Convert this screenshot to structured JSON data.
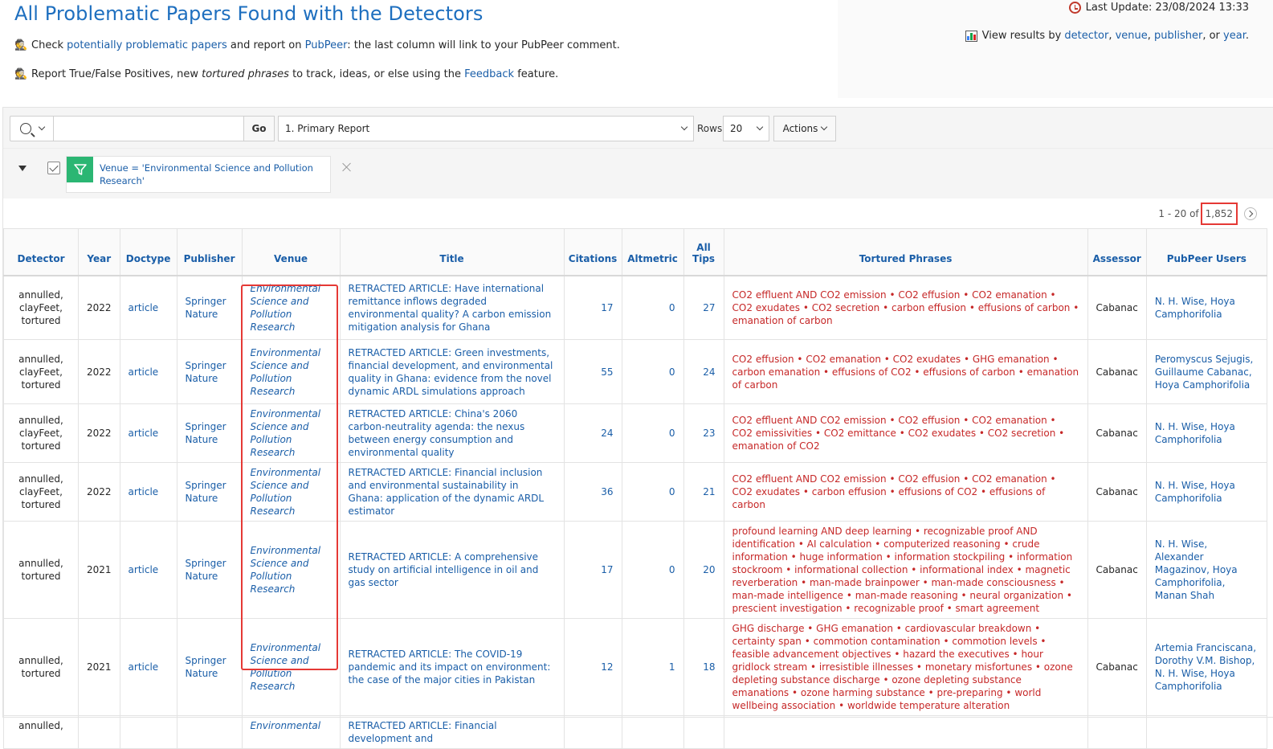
{
  "header": {
    "title": "All Problematic Papers Found with the Detectors",
    "line1": {
      "prefix": "Check ",
      "link1": "potentially problematic papers",
      "mid": " and report on ",
      "link2": "PubPeer",
      "suffix": ": the last column will link to your PubPeer comment."
    },
    "line2": {
      "prefix": "Report True/False Positives, new ",
      "italic": "tortured phrases",
      "mid": " to track, ideas, or else using the ",
      "link": "Feedback",
      "suffix": " feature."
    },
    "last_update": "Last Update: 23/08/2024 13:33",
    "view_results": {
      "prefix": "View results by ",
      "detector": "detector",
      "sep1": ", ",
      "venue": "venue",
      "sep2": ", ",
      "publisher": "publisher",
      "sep3": ", or ",
      "year": "year",
      "suffix": "."
    }
  },
  "toolbar": {
    "search_value": "",
    "go_label": "Go",
    "report_selected": "1. Primary Report",
    "rows_label": "Rows",
    "rows_value": "20",
    "actions_label": "Actions"
  },
  "filter": {
    "text": "Venue = 'Environmental Science and Pollution Research'"
  },
  "pagination": {
    "range": "1 - 20 of",
    "total": "1,852"
  },
  "table": {
    "columns": [
      "Detector",
      "Year",
      "Doctype",
      "Publisher",
      "Venue",
      "Title",
      "Citations",
      "Altmetric",
      "All Tips",
      "Tortured Phrases",
      "Assessor",
      "PubPeer Users"
    ],
    "rows": [
      {
        "detector": "annulled, clayFeet, tortured",
        "year": "2022",
        "doctype": "article",
        "publisher": "Springer Nature",
        "venue": "Environmental Science and Pollution Research",
        "title": "RETRACTED ARTICLE: Have international remittance inflows degraded environmental quality? A carbon emission mitigation analysis for Ghana",
        "citations": "17",
        "altmetric": "0",
        "tips": "27",
        "phrases": "CO2 effluent AND CO2 emission • CO2 effusion • CO2 emanation • CO2 exudates • CO2 secretion • carbon effusion • effusions of carbon • emanation of carbon",
        "assessor": "Cabanac",
        "users": "N. H. Wise, Hoya Camphorifolia"
      },
      {
        "detector": "annulled, clayFeet, tortured",
        "year": "2022",
        "doctype": "article",
        "publisher": "Springer Nature",
        "venue": "Environmental Science and Pollution Research",
        "title": "RETRACTED ARTICLE: Green investments, financial development, and environmental quality in Ghana: evidence from the novel dynamic ARDL simulations approach",
        "citations": "55",
        "altmetric": "0",
        "tips": "24",
        "phrases": "CO2 effusion • CO2 emanation • CO2 exudates • GHG emanation • carbon emanation • effusions of CO2 • effusions of carbon • emanation of carbon",
        "assessor": "Cabanac",
        "users": "Peromyscus Sejugis, Guillaume Cabanac, Hoya Camphorifolia"
      },
      {
        "detector": "annulled, clayFeet, tortured",
        "year": "2022",
        "doctype": "article",
        "publisher": "Springer Nature",
        "venue": "Environmental Science and Pollution Research",
        "title": "RETRACTED ARTICLE: China's 2060 carbon-neutrality agenda: the nexus between energy consumption and environmental quality",
        "citations": "24",
        "altmetric": "0",
        "tips": "23",
        "phrases": "CO2 effluent AND CO2 emission • CO2 effusion • CO2 emanation • CO2 emissivities • CO2 emittance • CO2 exudates • CO2 secretion • emanation of CO2",
        "assessor": "Cabanac",
        "users": "N. H. Wise, Hoya Camphorifolia"
      },
      {
        "detector": "annulled, clayFeet, tortured",
        "year": "2022",
        "doctype": "article",
        "publisher": "Springer Nature",
        "venue": "Environmental Science and Pollution Research",
        "title": "RETRACTED ARTICLE: Financial inclusion and environmental sustainability in Ghana: application of the dynamic ARDL estimator",
        "citations": "36",
        "altmetric": "0",
        "tips": "21",
        "phrases": "CO2 effluent AND CO2 emission • CO2 effusion • CO2 emanation • CO2 exudates • carbon effusion • effusions of CO2 • effusions of carbon",
        "assessor": "Cabanac",
        "users": "N. H. Wise, Hoya Camphorifolia"
      },
      {
        "detector": "annulled, tortured",
        "year": "2021",
        "doctype": "article",
        "publisher": "Springer Nature",
        "venue": "Environmental Science and Pollution Research",
        "title": "RETRACTED ARTICLE: A comprehensive study on artificial intelligence in oil and gas sector",
        "citations": "17",
        "altmetric": "0",
        "tips": "20",
        "phrases": "profound learning AND deep learning • recognizable proof AND identification • AI calculation • computerized reasoning • crude information • huge information • information stockpiling • information stockroom • informational collection • informational index • magnetic reverberation • man-made brainpower • man-made consciousness • man-made intelligence • man-made reasoning • neural organization • prescient investigation • recognizable proof • smart agreement",
        "assessor": "Cabanac",
        "users": "N. H. Wise, Alexander Magazinov, Hoya Camphorifolia, Manan Shah"
      },
      {
        "detector": "annulled, tortured",
        "year": "2021",
        "doctype": "article",
        "publisher": "Springer Nature",
        "venue": "Environmental Science and Pollution Research",
        "title": "RETRACTED ARTICLE: The COVID-19 pandemic and its impact on environment: the case of the major cities in Pakistan",
        "citations": "12",
        "altmetric": "1",
        "tips": "18",
        "phrases": "GHG discharge • GHG emanation • cardiovascular breakdown • certainty span • commotion contamination • commotion levels • feasible advancement objectives • hazard the executives • hour gridlock stream • irresistible illnesses • monetary misfortunes • ozone depleting substance discharge • ozone depleting substance emanations • ozone harming substance • pre-preparing • world wellbeing association • worldwide temperature alteration",
        "assessor": "Cabanac",
        "users": "Artemia Franciscana, Dorothy V.M. Bishop, N. H. Wise, Hoya Camphorifolia"
      },
      {
        "detector": "annulled,",
        "year": "",
        "doctype": "",
        "publisher": "",
        "venue": "Environmental",
        "title": "RETRACTED ARTICLE: Financial development and",
        "citations": "",
        "altmetric": "",
        "tips": "",
        "phrases": "",
        "assessor": "",
        "users": ""
      }
    ]
  }
}
